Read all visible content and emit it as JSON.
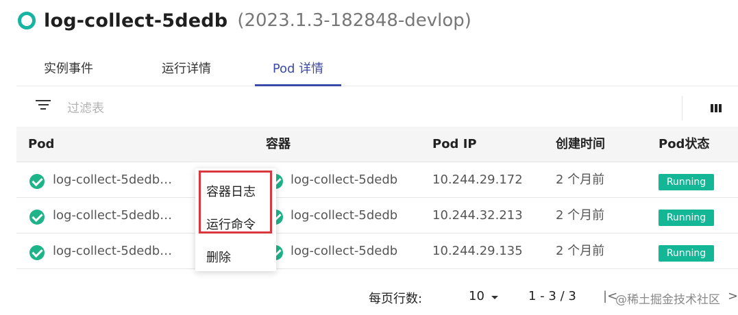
{
  "header": {
    "app_name": "log-collect-5dedb",
    "version": "(2023.1.3-182848-devlop)"
  },
  "tabs": [
    {
      "label": "实例事件"
    },
    {
      "label": "运行详情"
    },
    {
      "label": "Pod 详情",
      "active": true
    }
  ],
  "toolbar": {
    "filter_placeholder": "过滤表"
  },
  "table": {
    "columns": [
      "Pod",
      "容器",
      "Pod IP",
      "创建时间",
      "Pod状态"
    ],
    "rows": [
      {
        "pod": "log-collect-5dedb…",
        "container": "log-collect-5dedb",
        "ip": "10.244.29.172",
        "created": "2 个月前",
        "status": "Running"
      },
      {
        "pod": "log-collect-5dedb…",
        "container": "log-collect-5dedb",
        "ip": "10.244.32.213",
        "created": "2 个月前",
        "status": "Running"
      },
      {
        "pod": "log-collect-5dedb…",
        "container": "log-collect-5dedb",
        "ip": "10.244.29.135",
        "created": "2 个月前",
        "status": "Running"
      }
    ]
  },
  "context_menu": {
    "items": [
      "容器日志",
      "运行命令",
      "删除"
    ]
  },
  "pagination": {
    "rows_per_page_label": "每页行数:",
    "rows_per_page": "10",
    "range": "1 - 3 / 3",
    "first_symbol": "|<",
    "last_symbol": ">|"
  },
  "watermark": "@稀土掘金技术社区",
  "colors": {
    "accent": "#3b4aa6",
    "status_running": "#13b796",
    "check": "#1fb38a",
    "highlight": "#d9363e",
    "ring": "#17b3a3"
  }
}
